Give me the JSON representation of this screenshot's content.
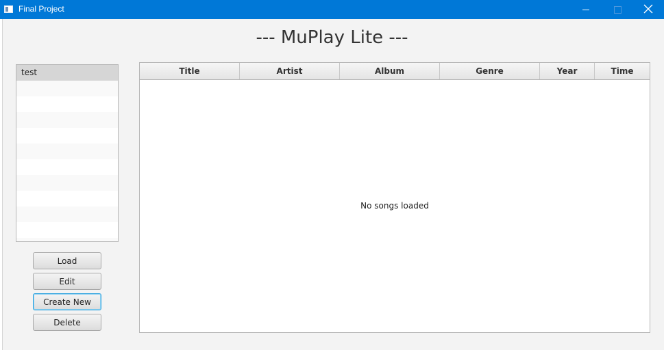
{
  "window": {
    "title": "Final Project",
    "controls": {
      "minimize_icon": "minimize-icon",
      "maximize_icon": "maximize-icon",
      "close_icon": "close-icon"
    },
    "titlebar_color": "#0078d7"
  },
  "app": {
    "heading": "--- MuPlay Lite ---"
  },
  "playlists": {
    "items": [
      "test"
    ],
    "selected": "test"
  },
  "buttons": {
    "load": "Load",
    "edit": "Edit",
    "create_new": "Create New",
    "delete": "Delete"
  },
  "song_table": {
    "columns": [
      "Title",
      "Artist",
      "Album",
      "Genre",
      "Year",
      "Time"
    ],
    "rows": [],
    "placeholder": "No songs loaded"
  },
  "colors": {
    "focus_accent": "#2ea3df"
  }
}
